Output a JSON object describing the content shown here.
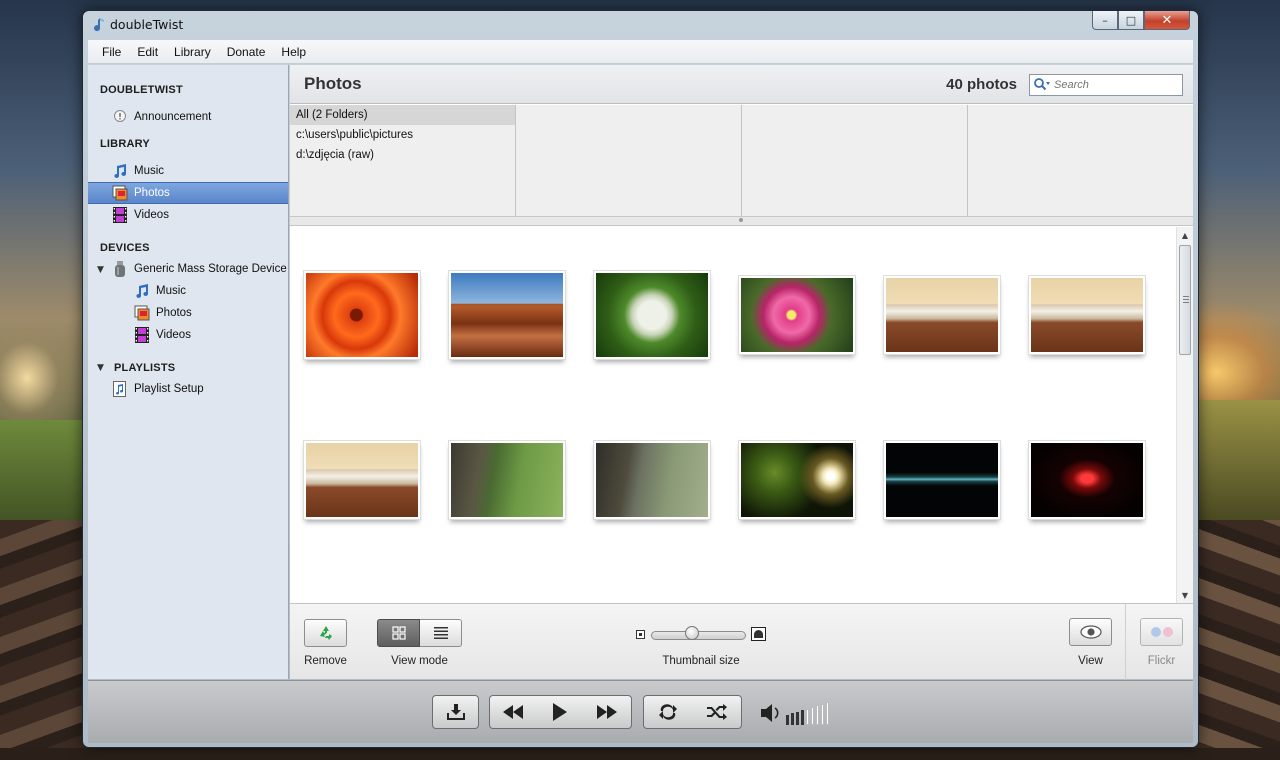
{
  "window": {
    "title": "doubleTwist",
    "controls": {
      "minimize": "–",
      "maximize": "□",
      "close": "✕"
    }
  },
  "menu": [
    "File",
    "Edit",
    "Library",
    "Donate",
    "Help"
  ],
  "sidebar": {
    "sections": [
      {
        "header": "DOUBLETWIST",
        "items": [
          {
            "label": "Announcement",
            "icon": "announcement-icon"
          }
        ]
      },
      {
        "header": "LIBRARY",
        "items": [
          {
            "label": "Music",
            "icon": "music-note-icon"
          },
          {
            "label": "Photos",
            "icon": "photos-icon",
            "selected": true
          },
          {
            "label": "Videos",
            "icon": "film-strip-icon"
          }
        ]
      },
      {
        "header": "DEVICES",
        "device": {
          "label": "Generic Mass Storage Device",
          "icon": "usb-device-icon",
          "expanded": true
        },
        "items": [
          {
            "label": "Music",
            "icon": "music-note-icon"
          },
          {
            "label": "Photos",
            "icon": "photos-icon"
          },
          {
            "label": "Videos",
            "icon": "film-strip-icon"
          }
        ]
      },
      {
        "header": "PLAYLISTS",
        "items": [
          {
            "label": "Playlist Setup",
            "icon": "playlist-icon"
          }
        ]
      }
    ]
  },
  "main": {
    "title": "Photos",
    "count": "40 photos",
    "search": {
      "placeholder": "Search",
      "value": ""
    },
    "folders": [
      "All (2 Folders)",
      "c:\\users\\public\\pictures",
      "d:\\zdjęcia (raw)"
    ],
    "photos": [
      {
        "subject": "orange-dahlia"
      },
      {
        "subject": "desert-butte"
      },
      {
        "subject": "white-hydrangea"
      },
      {
        "subject": "pink-flowers"
      },
      {
        "subject": "kitchen-microwave"
      },
      {
        "subject": "kitchen-microwave"
      },
      {
        "subject": "kitchen-microwave"
      },
      {
        "subject": "tree-trunk-insect"
      },
      {
        "subject": "tree-trunk-insect"
      },
      {
        "subject": "night-tree-light"
      },
      {
        "subject": "digital-display"
      },
      {
        "subject": "red-led-display"
      }
    ]
  },
  "toolbar": {
    "remove_label": "Remove",
    "view_mode_label": "View mode",
    "thumbnail_size_label": "Thumbnail size",
    "thumbnail_size_value": 0.42,
    "view_label": "View",
    "flickr_label": "Flickr"
  },
  "transport": {
    "volume_level": 0.5
  },
  "colors": {
    "selection": "#5a86ca",
    "sidebar_bg": "#dfe6ef",
    "close_button": "#c4412b"
  }
}
